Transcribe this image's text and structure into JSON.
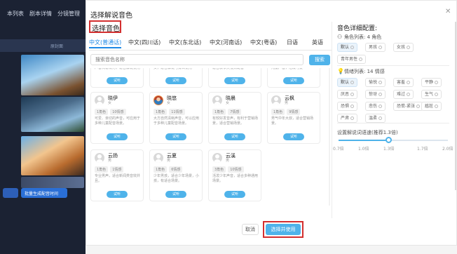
{
  "background_app": {
    "tabs": [
      "本列表",
      "剧本详情",
      "分镜管理"
    ],
    "column_header": "原封面",
    "row_buttons": [
      "",
      "批量生成配音时间"
    ]
  },
  "modal": {
    "title": "选择解说音色",
    "section_title": "选择音色",
    "lang_tabs": [
      {
        "label": "中文(普通话)",
        "active": true
      },
      {
        "label": "中文(四川话)",
        "active": false
      },
      {
        "label": "中文(东北话)",
        "active": false
      },
      {
        "label": "中文(河南话)",
        "active": false
      },
      {
        "label": "中文(粤语)",
        "active": false
      },
      {
        "label": "日语",
        "active": false
      },
      {
        "label": "英语",
        "active": false
      }
    ],
    "search": {
      "placeholder": "搜索音色名称",
      "button": "搜索"
    },
    "partial_cards": [
      {
        "desc": "声音沉稳有力，适合解说使用",
        "button": "试听"
      },
      {
        "desc": "女，适合解说与旁白使用",
        "button": "试听"
      },
      {
        "desc": "适合叙事类视频配音",
        "button": "试听"
      },
      {
        "desc": "儿童声音，活泼可爱",
        "button": "试听"
      }
    ],
    "voices": [
      {
        "name": "晓伊",
        "gender": "女",
        "tags": [
          "1角色",
          "10情感"
        ],
        "desc": "可爱、亲切的声音，可应用于多种儿童配音场景。",
        "button": "试听",
        "photo": false
      },
      {
        "name": "晓悠",
        "gender": "女",
        "tags": [
          "1角色",
          "11情感"
        ],
        "desc": "大方自然清晰声音，可以应用于多种儿童配音场景。",
        "button": "试听",
        "photo": true
      },
      {
        "name": "晓晨",
        "gender": "女",
        "tags": [
          "1角色",
          "7情感"
        ],
        "desc": "有较好发音声，有利于营销场景，适合营销场景。",
        "button": "试听",
        "photo": false
      },
      {
        "name": "云枫",
        "gender": "男",
        "tags": [
          "1角色",
          "9情感"
        ],
        "desc": "男气中年大叔，适合营销场景。",
        "button": "试听",
        "photo": false
      },
      {
        "name": "云扬",
        "gender": "男",
        "tags": [
          "1角色",
          "1情感"
        ],
        "desc": "专业男声，适合新闻类音效并且。",
        "button": "试听",
        "photo": false
      },
      {
        "name": "云夏",
        "gender": "男",
        "tags": [
          "1角色",
          "6情感"
        ],
        "desc": "少年男孩，适合少年场景，小孩，有适合场景。",
        "button": "试听",
        "photo": false
      },
      {
        "name": "云溪",
        "gender": "男",
        "tags": [
          "3角色",
          "10情感"
        ],
        "desc": "活泼少年声音，适合多种通用场景。",
        "button": "试听",
        "photo": false
      }
    ],
    "footer": {
      "cancel": "取消",
      "confirm": "选择并使用"
    }
  },
  "config": {
    "title": "音色详细配置:",
    "roles_label": "角色列表: 4 角色",
    "roles": [
      {
        "label": "默认",
        "selected": true
      },
      {
        "label": "男孩",
        "selected": false
      },
      {
        "label": "女孩",
        "selected": false
      },
      {
        "label": "青年男性",
        "selected": false
      }
    ],
    "emotions_label": "情绪列表: 14 情感",
    "emotions": [
      {
        "label": "默认",
        "selected": true
      },
      {
        "label": "愉悦",
        "selected": false
      },
      {
        "label": "害羞",
        "selected": false
      },
      {
        "label": "平静",
        "selected": false
      },
      {
        "label": "厌恶",
        "selected": false
      },
      {
        "label": "惊讶",
        "selected": false
      },
      {
        "label": "难过",
        "selected": false
      },
      {
        "label": "生气",
        "selected": false
      },
      {
        "label": "恐惧",
        "selected": false
      },
      {
        "label": "悲伤",
        "selected": false
      },
      {
        "label": "恐慌-紧张",
        "selected": false
      },
      {
        "label": "尴尬",
        "selected": false
      },
      {
        "label": "严肃",
        "selected": false
      },
      {
        "label": "温柔",
        "selected": false
      }
    ],
    "speed_label": "设置解说词语速(推荐1.3倍)",
    "speed_ticks": [
      "0.7倍",
      "1.0倍",
      "1.3倍",
      "1.7倍",
      "2.0倍"
    ],
    "speed_value": 1.3,
    "speed_min": 0.7,
    "speed_max": 2.0
  },
  "colors": {
    "accent": "#4fb3ea",
    "highlight": "#d32f2f",
    "active_tab": "#1e88e5"
  }
}
